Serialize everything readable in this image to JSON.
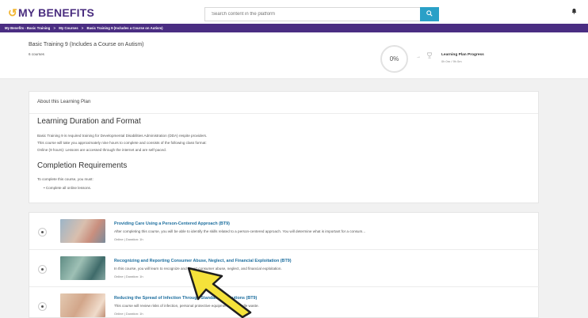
{
  "header": {
    "logo_mark": "↺",
    "logo_text": "MY BENEFITS",
    "search_placeholder": "Search content in the platform",
    "search_icon": "search-icon",
    "bell_icon": "bell-icon"
  },
  "breadcrumb": {
    "items": [
      "My Benefits - Basic Training",
      ">",
      "My Courses",
      ">",
      "Basic Training 9 (Includes a Course on Autism)"
    ]
  },
  "plan": {
    "title": "Basic Training 9 (Includes a Course on Autism)",
    "courses_count": "6 courses",
    "progress_percent": "0%",
    "progress_label": "Learning Plan Progress",
    "progress_time": "0h 0m / 9h 0m"
  },
  "about": {
    "header": "About this Learning Plan",
    "duration_heading": "Learning Duration and Format",
    "p1": "Basic Training 9 is required training for Developmental Disabilities Administration (DDA) respite providers.",
    "p2": "This course will take you approximately nine hours to complete and consists of the following class format:",
    "p3": "Online (9 hours): Lessons are accessed through the internet and are self-paced.",
    "completion_heading": "Completion Requirements",
    "p4": "To complete this course, you must:",
    "bullet": "Complete all online lessons."
  },
  "courses": [
    {
      "title": "Providing Care Using a Person-Centered Approach (BT9)",
      "desc": "After completing this course, you will be able to identify the skills related to a person-centered approach. You will determine what is important for a consum...",
      "meta": "Online | Duration: 1h"
    },
    {
      "title": "Recognizing and Reporting Consumer Abuse, Neglect, and Financial Exploitation (BT9)",
      "desc": "In this course, you will learn to recognize and report consumer abuse, neglect, and financial exploitation.",
      "meta": "Online | Duration: 1h"
    },
    {
      "title": "Reducing the Spread of Infection Through Standard Precautions (BT9)",
      "desc": "This course will review risks of infection, personal protective equipment and handle waste.",
      "meta": "Online | Duration: 1h"
    }
  ],
  "annotation": {
    "arrow_color": "#f5e23a",
    "arrow_outline": "#1f1f1f"
  }
}
